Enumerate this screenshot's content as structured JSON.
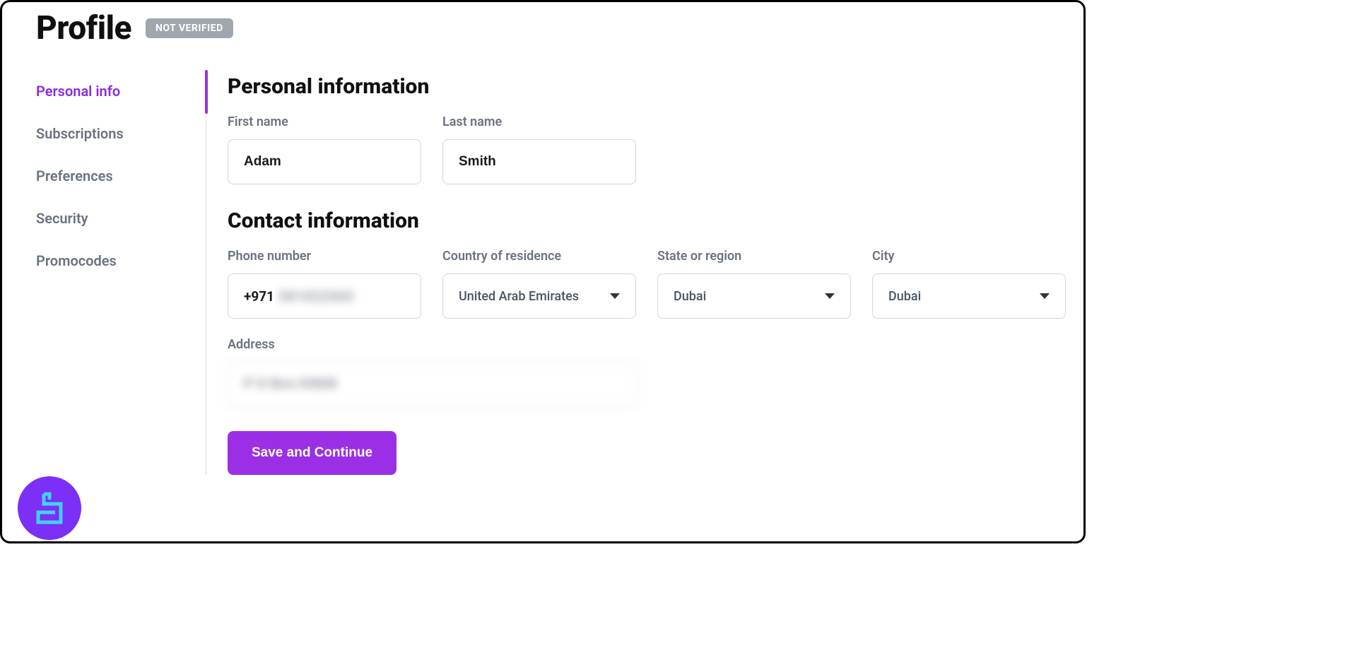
{
  "header": {
    "title": "Profile",
    "badge": "NOT VERIFIED"
  },
  "sidebar": {
    "items": [
      {
        "label": "Personal info",
        "active": true
      },
      {
        "label": "Subscriptions",
        "active": false
      },
      {
        "label": "Preferences",
        "active": false
      },
      {
        "label": "Security",
        "active": false
      },
      {
        "label": "Promocodes",
        "active": false
      }
    ]
  },
  "sections": {
    "personal": {
      "title": "Personal information",
      "first_name_label": "First name",
      "first_name_value": "Adam",
      "last_name_label": "Last name",
      "last_name_value": "Smith"
    },
    "contact": {
      "title": "Contact information",
      "phone_label": "Phone number",
      "phone_prefix": "+971",
      "phone_obscured": "581022565",
      "country_label": "Country of residence",
      "country_value": "United Arab Emirates",
      "state_label": "State or region",
      "state_value": "Dubai",
      "city_label": "City",
      "city_value": "Dubai",
      "address_label": "Address",
      "address_value_obscured": "P O Box 63928"
    }
  },
  "actions": {
    "save_label": "Save and Continue"
  },
  "colors": {
    "accent": "#9b2fe6",
    "badge_bg": "#a0a6ae",
    "muted_text": "#6b7280",
    "logo_bg": "#7b2ff7"
  }
}
